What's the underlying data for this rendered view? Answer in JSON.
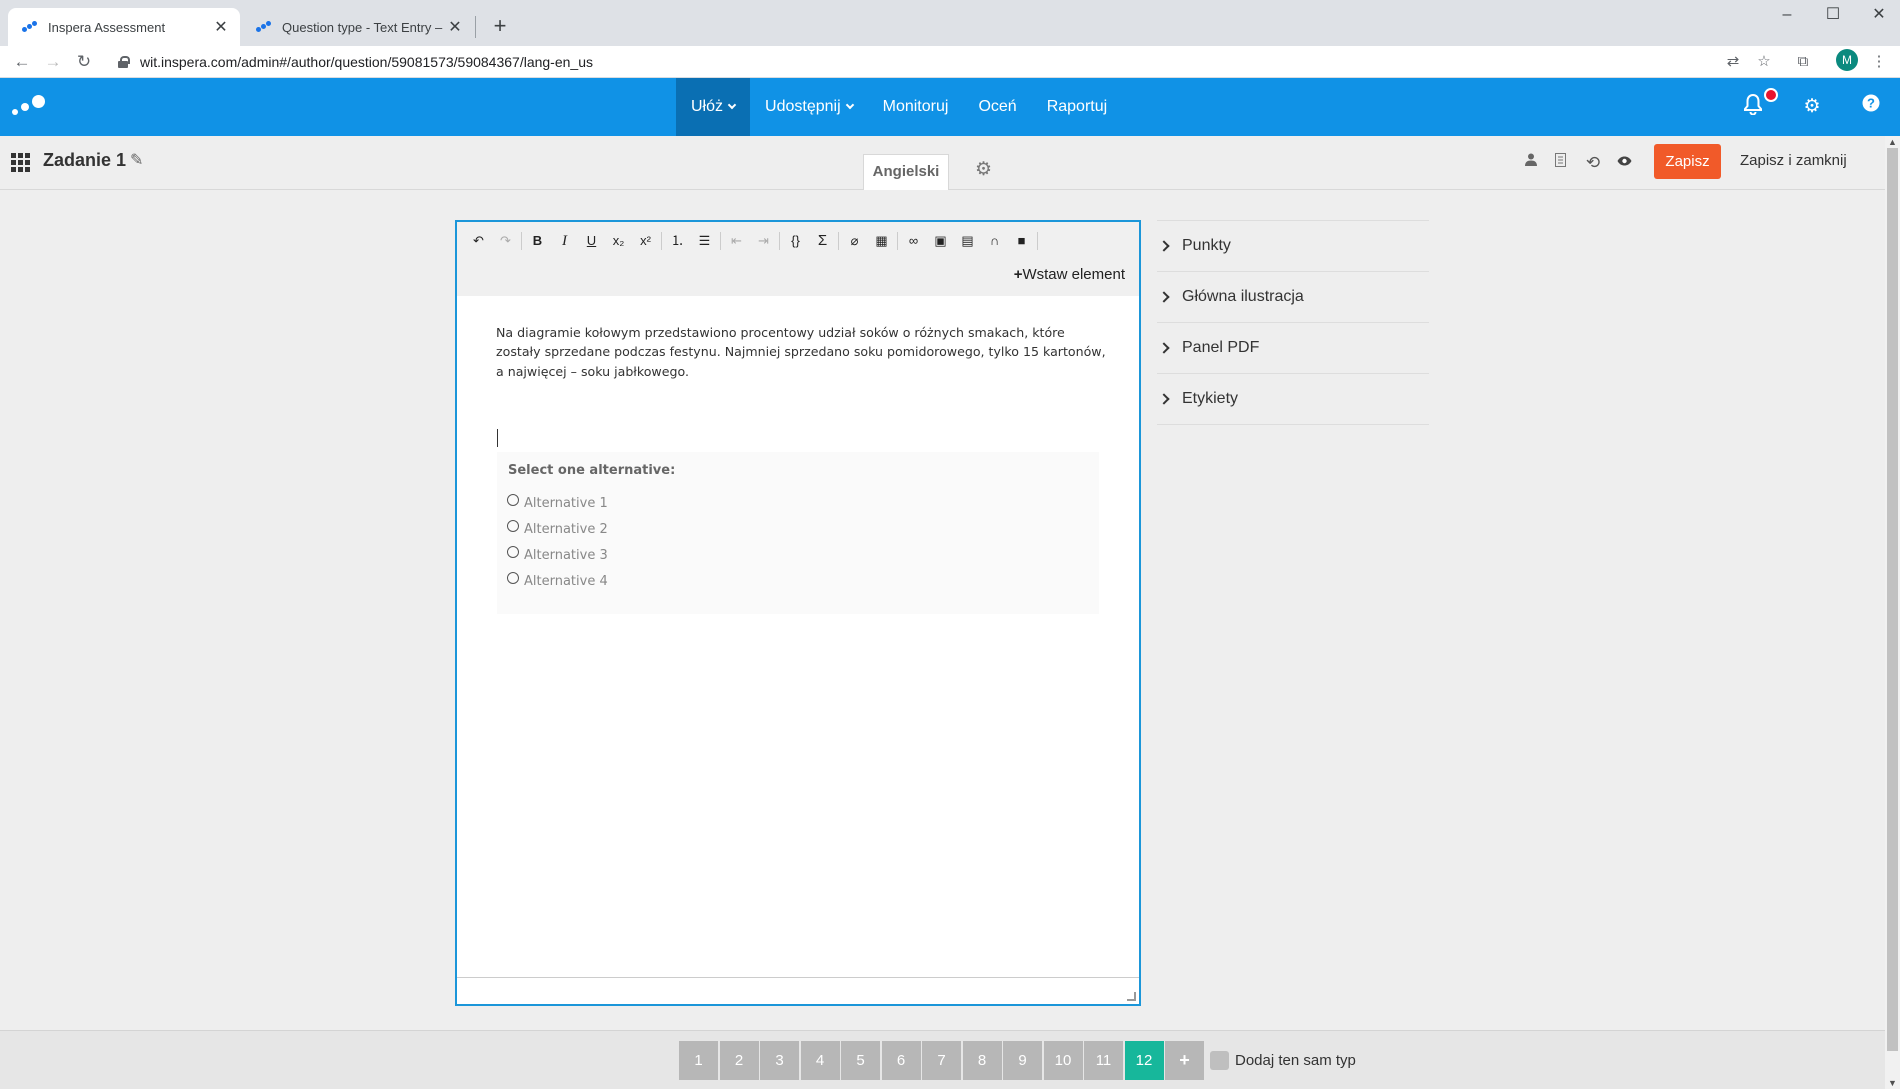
{
  "browser": {
    "tabs": [
      {
        "title": "Inspera Assessment",
        "active": true
      },
      {
        "title": "Question type - Text Entry – Insp",
        "active": false
      }
    ],
    "url": "wit.inspera.com/admin#/author/question/59081573/59084367/lang-en_us",
    "profile_initial": "M"
  },
  "appbar": {
    "nav": [
      {
        "label": "Ułóż",
        "dropdown": true,
        "active": true
      },
      {
        "label": "Udostępnij",
        "dropdown": true,
        "active": false
      },
      {
        "label": "Monitoruj"
      },
      {
        "label": "Oceń"
      },
      {
        "label": "Raportuj"
      }
    ],
    "icons": [
      "bell-icon",
      "gear-icon",
      "help-icon"
    ],
    "accent": "#1092e6"
  },
  "subbar": {
    "title": "Zadanie 1",
    "language_tab": "Angielski",
    "save_label": "Zapisz",
    "save_close_label": "Zapisz i zamknij",
    "save_color": "#f15a29"
  },
  "editor": {
    "insert_label": "Wstaw element",
    "body_text": "Na diagramie kołowym przedstawiono procentowy udział soków o różnych smakach, które zostały sprzedane podczas festynu. Najmniej sprzedano soku pomidorowego, tylko 15 kartonów, a najwięcej – soku jabłkowego.",
    "choice": {
      "title": "Select one alternative:",
      "alternatives": [
        "Alternative 1",
        "Alternative 2",
        "Alternative 3",
        "Alternative 4"
      ]
    }
  },
  "panel": {
    "sections": [
      "Punkty",
      "Główna ilustracja",
      "Panel PDF",
      "Etykiety"
    ]
  },
  "bottombar": {
    "pages": [
      "1",
      "2",
      "3",
      "4",
      "5",
      "6",
      "7",
      "8",
      "9",
      "10",
      "11",
      "12"
    ],
    "active_page": "12",
    "add_label": "+",
    "same_type_label": "Dodaj ten sam typ",
    "active_color": "#17b79b"
  }
}
